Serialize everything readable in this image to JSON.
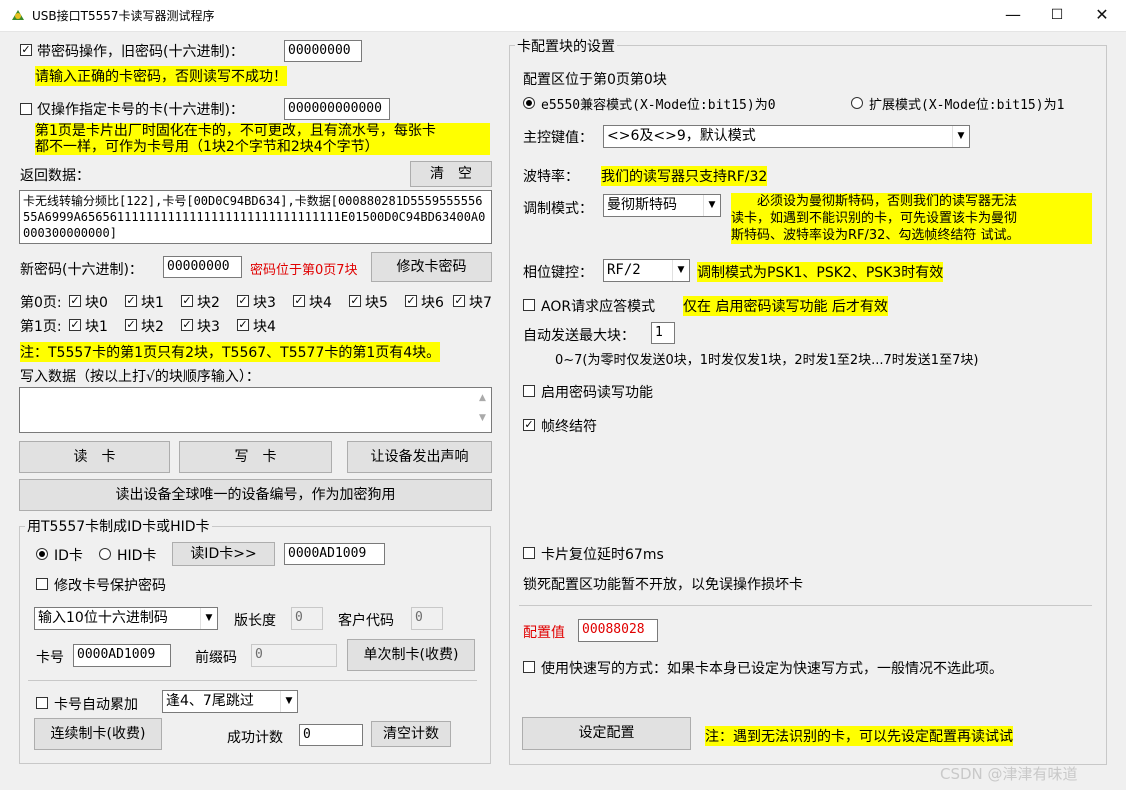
{
  "window": {
    "title": "USB接口T5557卡读写器测试程序",
    "minimize": "—",
    "maximize": "☐",
    "close": "✕"
  },
  "left": {
    "pwd_op": {
      "checked": true,
      "label": "带密码操作，旧密码(十六进制)：",
      "value": "00000000"
    },
    "pwd_hint": "请输入正确的卡密码，否则读写不成功！",
    "card_only": {
      "checked": false,
      "label": "仅操作指定卡号的卡(十六进制)：",
      "value": "000000000000"
    },
    "page1_note_line1": "第1页是卡片出厂时固化在卡的，不可更改，且有流水号，每张卡",
    "page1_note_line2": "都不一样，可作为卡号用（1块2个字节和2块4个字节）",
    "return_label": "返回数据：",
    "clear_btn": "清　空",
    "return_text": "卡无线转输分频比[122],卡号[00D0C94BD634],卡数据[000880281D555955555655A6999A656561111111111111111111111111111111E01500D0C94BD63400A0000300000000]",
    "new_pwd_label": "新密码(十六进制)：",
    "new_pwd_value": "00000000",
    "new_pwd_note": "密码位于第0页7块",
    "change_pwd_btn": "修改卡密码",
    "page0_label": "第0页:",
    "page0_blocks": [
      {
        "label": "块0",
        "checked": true
      },
      {
        "label": "块1",
        "checked": true
      },
      {
        "label": "块2",
        "checked": true
      },
      {
        "label": "块3",
        "checked": true
      },
      {
        "label": "块4",
        "checked": true
      },
      {
        "label": "块5",
        "checked": true
      },
      {
        "label": "块6",
        "checked": true
      },
      {
        "label": "块7",
        "checked": true
      }
    ],
    "page1_label": "第1页:",
    "page1_blocks": [
      {
        "label": "块1",
        "checked": true
      },
      {
        "label": "块2",
        "checked": true
      },
      {
        "label": "块3",
        "checked": true
      },
      {
        "label": "块4",
        "checked": true
      }
    ],
    "t5557_note": "注：T5557卡的第1页只有2块，T5567、T5577卡的第1页有4块。",
    "write_label": "写入数据（按以上打√的块顺序输入）：",
    "write_value": "",
    "read_btn": "读　卡",
    "write_btn": "写　卡",
    "beep_btn": "让设备发出声响",
    "uid_btn": "读出设备全球唯一的设备编号，作为加密狗用",
    "id_group": {
      "title": "用T5557卡制成ID卡或HID卡",
      "id_radio": "ID卡",
      "hid_radio": "HID卡",
      "read_id_btn": "读ID卡>>",
      "id_value": "0000AD1009",
      "modify_protect": "修改卡号保护密码",
      "input_mode": "输入10位十六进制码",
      "version_label": "版长度",
      "version_value": "0",
      "customer_label": "客户代码",
      "customer_value": "0",
      "card_no_label": "卡号",
      "card_no_value": "0000AD1009",
      "prefix_label": "前缀码",
      "prefix_value": "0",
      "single_btn": "单次制卡(收费)",
      "auto_inc": "卡号自动累加",
      "skip_mode": "逢4、7尾跳过",
      "continuous_btn": "连续制卡(收费)",
      "success_label": "成功计数",
      "success_value": "0",
      "clear_count_btn": "清空计数"
    }
  },
  "right": {
    "group_title": "卡配置块的设置",
    "config_loc": "配置区位于第0页第0块",
    "mode_e5550": "e5550兼容模式(X-Mode位:bit15)为0",
    "mode_ext": "扩展模式(X-Mode位:bit15)为1",
    "master_key_label": "主控键值：",
    "master_key_value": "<>6及<>9，默认模式",
    "baud_label": "波特率：",
    "baud_note": "我们的读写器只支持RF/32",
    "mod_label": "调制模式：",
    "mod_value": "曼彻斯特码",
    "mod_note_l1": "　　必须设为曼彻斯特码，否则我们的读写器无法",
    "mod_note_l2": "读卡，如遇到不能识别的卡，可先设置该卡为曼彻",
    "mod_note_l3": "斯特码、波特率设为RF/32、勾选帧终结符 试试。",
    "phase_label": "相位键控：",
    "phase_value": "RF/2",
    "phase_note": "调制模式为PSK1、PSK2、PSK3时有效",
    "aor_label": "AOR请求应答模式",
    "aor_note": "仅在 启用密码读写功能 后才有效",
    "auto_send_label": "自动发送最大块：",
    "auto_send_value": "1",
    "auto_send_note": "0~7(为零时仅发送0块，1时发仅发1块，2时发1至2块...7时发送1至7块)",
    "enable_pwd": "启用密码读写功能",
    "frame_end": "帧终结符",
    "reset_delay": "卡片复位延时67ms",
    "lock_note": "锁死配置区功能暂不开放，以免误操作损坏卡",
    "config_value_label": "配置值",
    "config_value": "00088028",
    "fast_write": "使用快速写的方式：如果卡本身已设定为快速写方式，一般情况不选此项。",
    "set_config_btn": "设定配置",
    "final_note": "注：遇到无法识别的卡，可以先设定配置再读试试"
  },
  "watermark": "CSDN @津津有味道"
}
